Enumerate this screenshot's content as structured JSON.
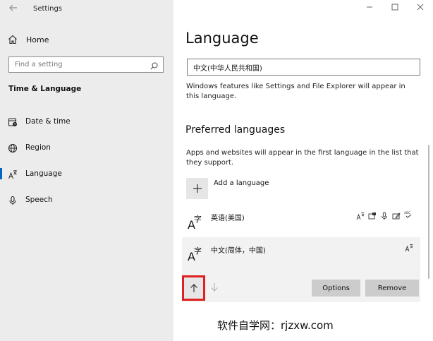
{
  "window": {
    "title": "Settings"
  },
  "sidebar": {
    "home_label": "Home",
    "search_placeholder": "Find a setting",
    "section_title": "Time & Language",
    "items": [
      {
        "label": "Date & time",
        "icon": "calendar-clock-icon",
        "active": false
      },
      {
        "label": "Region",
        "icon": "globe-icon",
        "active": false
      },
      {
        "label": "Language",
        "icon": "language-icon",
        "active": true
      },
      {
        "label": "Speech",
        "icon": "microphone-icon",
        "active": false
      }
    ]
  },
  "main": {
    "title": "Language",
    "display_language_value": "中文(中华人民共和国)",
    "display_language_desc": "Windows features like Settings and File Explorer will appear in this language.",
    "preferred_title": "Preferred languages",
    "preferred_desc": "Apps and websites will appear in the first language in the list that they support.",
    "add_language_label": "Add a language",
    "languages": [
      {
        "name": "英语(美国)",
        "features": [
          "display-language-icon",
          "speech-icon",
          "microphone-icon",
          "handwriting-icon",
          "spellcheck-icon"
        ]
      },
      {
        "name": "中文(简体，中国)",
        "features": [
          "display-language-icon"
        ]
      }
    ],
    "options_label": "Options",
    "remove_label": "Remove"
  },
  "watermark": "软件自学网：rjzxw.com",
  "colors": {
    "accent": "#0067c0",
    "highlight_border": "#e02020",
    "sidebar_bg": "#ececec"
  }
}
